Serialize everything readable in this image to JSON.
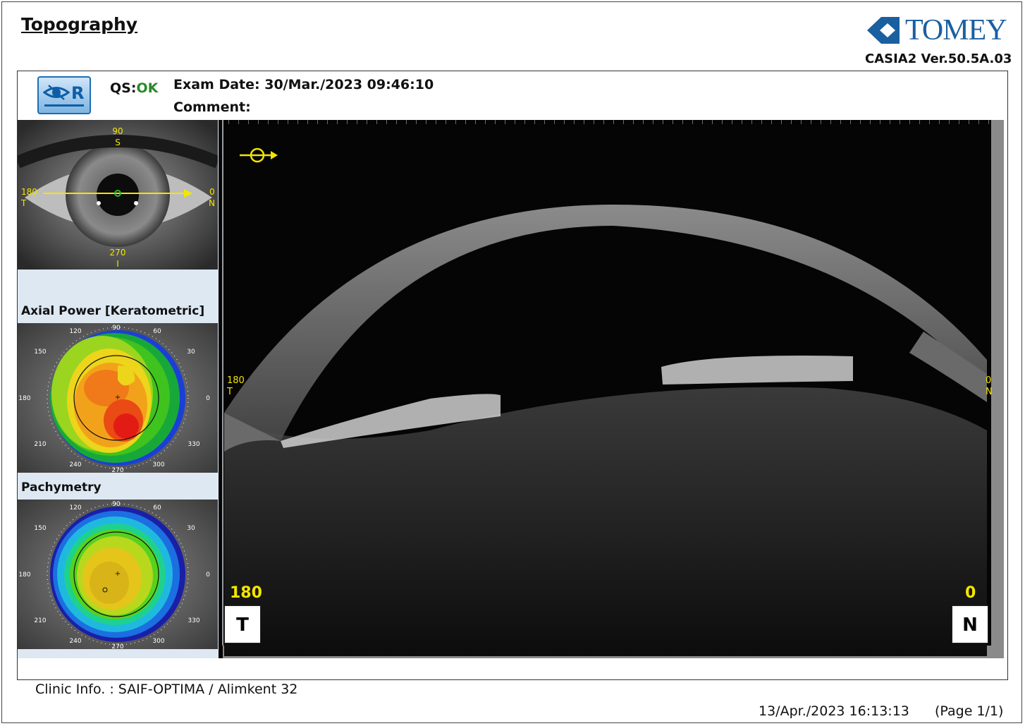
{
  "title": "Topography",
  "brand": {
    "name": "TOMEY",
    "version": "CASIA2 Ver.50.5A.03",
    "color": "#1a5fa0"
  },
  "eye_button": {
    "label": "R",
    "icon": "eye-icon"
  },
  "qs": {
    "label": "QS:",
    "value": "OK"
  },
  "exam": {
    "date": "Exam Date: 30/Mar./2023 09:46:10",
    "comment": "Comment:"
  },
  "eye_photo": {
    "top_deg": "90",
    "top_dir": "S",
    "left_deg": "180",
    "left_dir": "T",
    "right_deg": "0",
    "right_dir": "N",
    "bottom_deg": "270",
    "bottom_dir": "I"
  },
  "axial_map": {
    "label": "Axial Power [Keratometric]",
    "ticks": [
      "90",
      "60",
      "30",
      "0",
      "330",
      "300",
      "270",
      "240",
      "210",
      "180",
      "150",
      "120"
    ]
  },
  "pachy_map": {
    "label": "Pachymetry",
    "ticks": [
      "90",
      "60",
      "30",
      "0",
      "330",
      "300",
      "270",
      "240",
      "210",
      "180",
      "150",
      "120"
    ]
  },
  "oct": {
    "left_deg": "180",
    "left_dir": "T",
    "right_deg": "0",
    "right_dir": "N",
    "small_left_deg": "180",
    "small_left_dir": "T",
    "small_right_deg": "0",
    "small_right_dir": "N",
    "label_color": "#f3e600"
  },
  "footer": {
    "clinic": "Clinic Info. :   SAIF-OPTIMA / Alimkent 32",
    "printed": "13/Apr./2023 16:13:13",
    "page": "(Page 1/1)"
  }
}
